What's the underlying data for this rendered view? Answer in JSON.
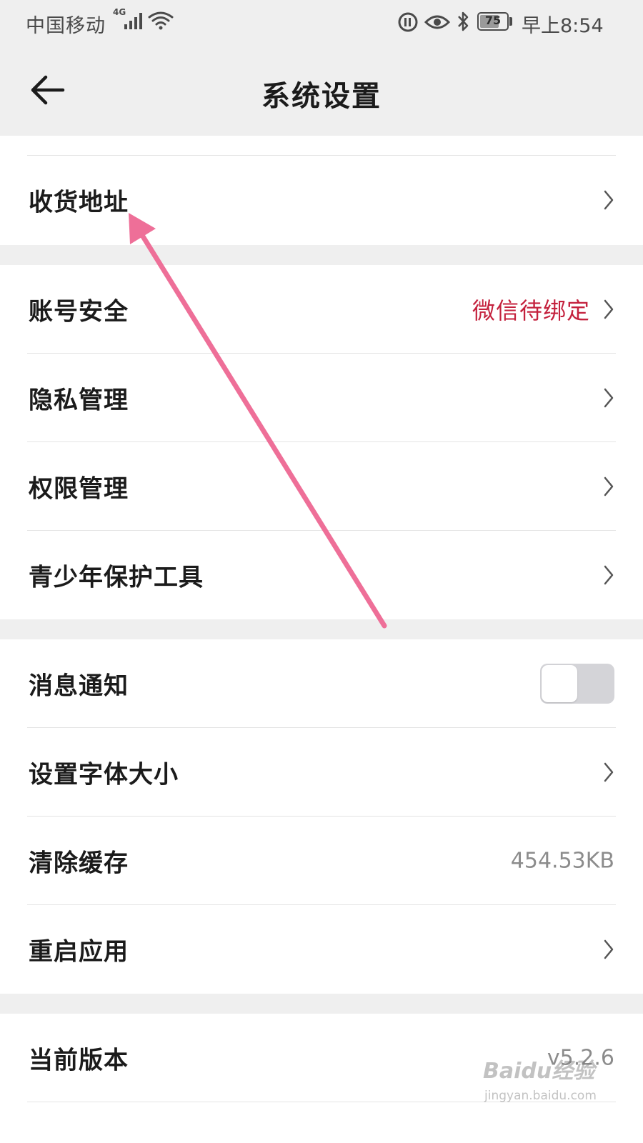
{
  "status_bar": {
    "carrier": "中国移动",
    "network": "4G",
    "battery": "75",
    "battery_level": 0.75,
    "time": "早上8:54"
  },
  "header": {
    "title": "系统设置"
  },
  "section_address": {
    "items": [
      {
        "label": "收货地址"
      }
    ]
  },
  "section_account": {
    "items": [
      {
        "label": "账号安全",
        "value": "微信待绑定"
      },
      {
        "label": "隐私管理"
      },
      {
        "label": "权限管理"
      },
      {
        "label": "青少年保护工具"
      }
    ]
  },
  "section_general": {
    "items": [
      {
        "label": "消息通知",
        "toggle_on": false
      },
      {
        "label": "设置字体大小"
      },
      {
        "label": "清除缓存",
        "value": "454.53KB"
      },
      {
        "label": "重启应用"
      }
    ]
  },
  "section_about": {
    "items": [
      {
        "label": "当前版本",
        "value": "v5.2.6"
      }
    ]
  },
  "watermark": {
    "logo": "Baidu经验",
    "url": "jingyan.baidu.com"
  },
  "colors": {
    "accent_red": "#c4213d",
    "annotation_pink": "#ee6f98",
    "page_background": "#efefef"
  },
  "icons": [
    "back-arrow-icon",
    "chevron-right-icon",
    "wifi-icon",
    "bluetooth-icon",
    "eye-icon",
    "battery-icon"
  ]
}
